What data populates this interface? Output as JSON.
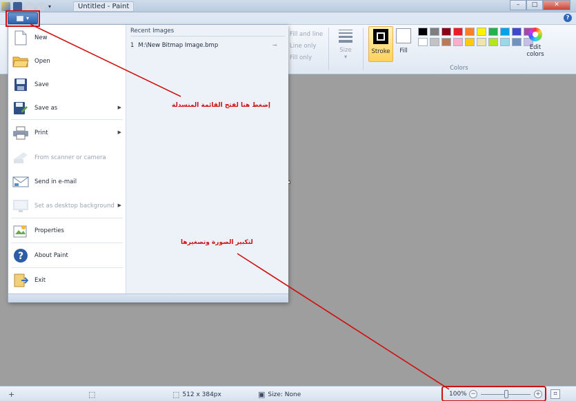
{
  "window": {
    "title": "Untitled - Paint",
    "controls": {
      "minimize": "–",
      "maximize": "□",
      "close": "✕"
    }
  },
  "ribbon": {
    "help": "?",
    "fill_options": [
      "Fill and line",
      "Line only",
      "Fill only"
    ],
    "size_label": "Size",
    "stroke_label": "Stroke",
    "fill_label": "Fill",
    "edit_colors_line1": "Edit",
    "edit_colors_line2": "colors",
    "colors_group_label": "Colors",
    "palette_row1": [
      "#000000",
      "#7f7f7f",
      "#880015",
      "#ed1c24",
      "#ff7f27",
      "#fff200",
      "#22b14c",
      "#00a2e8",
      "#3f48cc",
      "#a349a4"
    ],
    "palette_row2": [
      "#ffffff",
      "#c3c3c3",
      "#b97a57",
      "#ffaec9",
      "#ffc90e",
      "#efe4b0",
      "#b5e61d",
      "#99d9ea",
      "#7092be",
      "#c8bfe7"
    ]
  },
  "app_menu": {
    "items": [
      {
        "label": "New",
        "icon": "new-page-icon"
      },
      {
        "label": "Open",
        "icon": "open-folder-icon"
      },
      {
        "label": "Save",
        "icon": "save-disk-icon"
      },
      {
        "label": "Save as",
        "icon": "save-as-icon",
        "arrow": "▶"
      },
      {
        "label": "Print",
        "icon": "printer-icon",
        "arrow": "▶"
      },
      {
        "label": "From scanner or camera",
        "icon": "scanner-icon"
      },
      {
        "label": "Send in e-mail",
        "icon": "email-icon"
      },
      {
        "label": "Set as desktop background",
        "icon": "desktop-background-icon",
        "arrow": "▶"
      },
      {
        "label": "Properties",
        "icon": "properties-icon"
      },
      {
        "label": "About Paint",
        "icon": "help-icon"
      },
      {
        "label": "Exit",
        "icon": "exit-icon"
      }
    ],
    "recent_heading": "Recent Images",
    "recent_items": [
      {
        "index": "1",
        "path": "M:\\New Bitmap Image.bmp"
      }
    ],
    "pin": "⊸"
  },
  "status": {
    "cursor_icon": "+",
    "selection_icon": "⬚",
    "image_size": "512 x 384px",
    "file_size": "Size: None",
    "zoom": "100%",
    "zoom_minus": "−",
    "zoom_plus": "+"
  },
  "annotations": {
    "menu_note": "إضغط هنا لفتح القائمة المنسدلة",
    "zoom_note": "لتكبير الصورة وتصغيرها",
    "color": "#d01010"
  }
}
